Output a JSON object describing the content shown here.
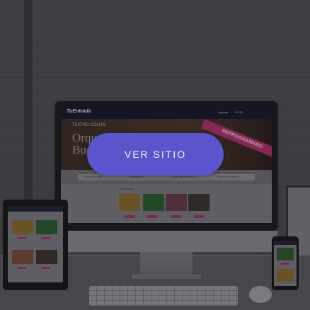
{
  "colors": {
    "cta_bg": "#5a55cc",
    "ribbon": "#b0306a",
    "site_nav": "#15152e"
  },
  "site": {
    "logo": "TuEntrada",
    "nav_items": [
      "Ingresar",
      "EVITA"
    ],
    "hero_org": "TEATRO COLÓN",
    "hero_title": "Orquesta Filarmónica de Buenos Aires",
    "hero_ribbon": "REPROGRAMADO",
    "search_fields": [
      "Buscar Evento",
      "Categorías",
      "Todas las ciudades",
      "Seleccionar fecha"
    ],
    "section_title": "Destacados"
  },
  "cta": {
    "label": "VER SITIO"
  }
}
